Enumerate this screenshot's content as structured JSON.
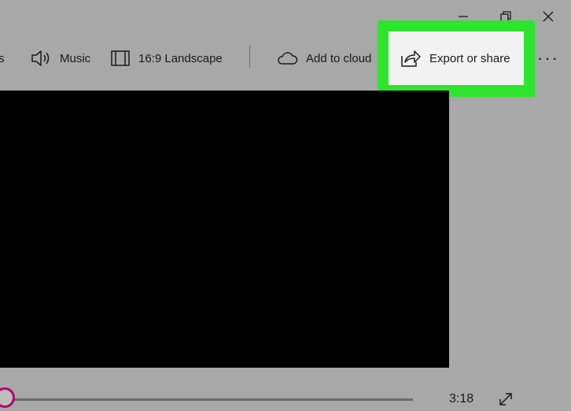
{
  "toolbar": {
    "partial_left": "s",
    "music_label": "Music",
    "aspect_label": "16:9 Landscape",
    "cloud_label": "Add to cloud",
    "export_label": "Export or share",
    "more_label": "···"
  },
  "playback": {
    "time": "3:18",
    "progress": 0.0
  },
  "colors": {
    "window_bg": "#a8a8a8",
    "highlight": "#2ee52e",
    "button_bg": "#f2f2f2",
    "preview": "#000000",
    "thumb_ring": "#b40070"
  }
}
